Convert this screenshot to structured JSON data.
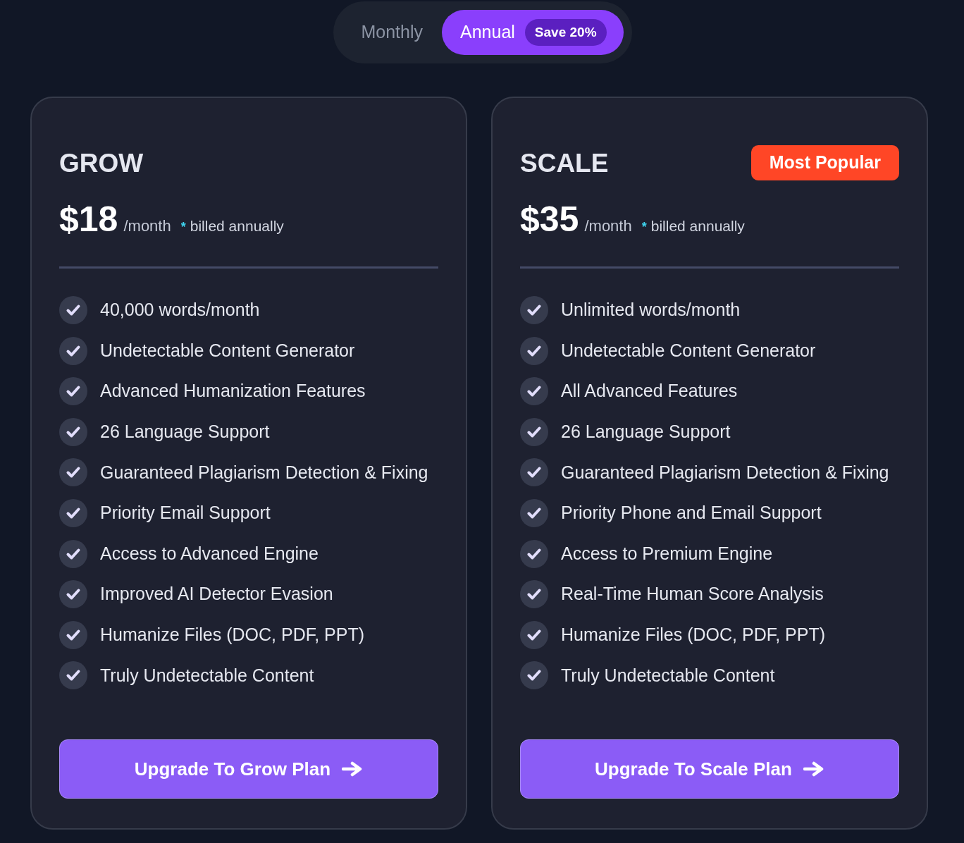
{
  "billing_toggle": {
    "options": [
      {
        "label": "Monthly",
        "selected": false
      },
      {
        "label": "Annual",
        "selected": true,
        "badge": "Save 20%"
      }
    ]
  },
  "plans": [
    {
      "name": "GROW",
      "price": "$18",
      "period": "/month",
      "note_mark": "*",
      "note": "billed annually",
      "features": [
        "40,000 words/month",
        "Undetectable Content Generator",
        "Advanced Humanization Features",
        "26 Language Support",
        "Guaranteed Plagiarism Detection & Fixing",
        "Priority Email Support",
        "Access to Advanced Engine",
        "Improved AI Detector Evasion",
        "Humanize Files (DOC, PDF, PPT)",
        "Truly Undetectable Content"
      ],
      "cta": "Upgrade To Grow Plan"
    },
    {
      "name": "SCALE",
      "badge": "Most Popular",
      "price": "$35",
      "period": "/month",
      "note_mark": "*",
      "note": "billed annually",
      "features": [
        "Unlimited words/month",
        "Undetectable Content Generator",
        "All Advanced Features",
        "26 Language Support",
        "Guaranteed Plagiarism Detection & Fixing",
        "Priority Phone and Email Support",
        "Access to Premium Engine",
        "Real-Time Human Score Analysis",
        "Humanize Files (DOC, PDF, PPT)",
        "Truly Undetectable Content"
      ],
      "cta": "Upgrade To Scale Plan"
    }
  ]
}
